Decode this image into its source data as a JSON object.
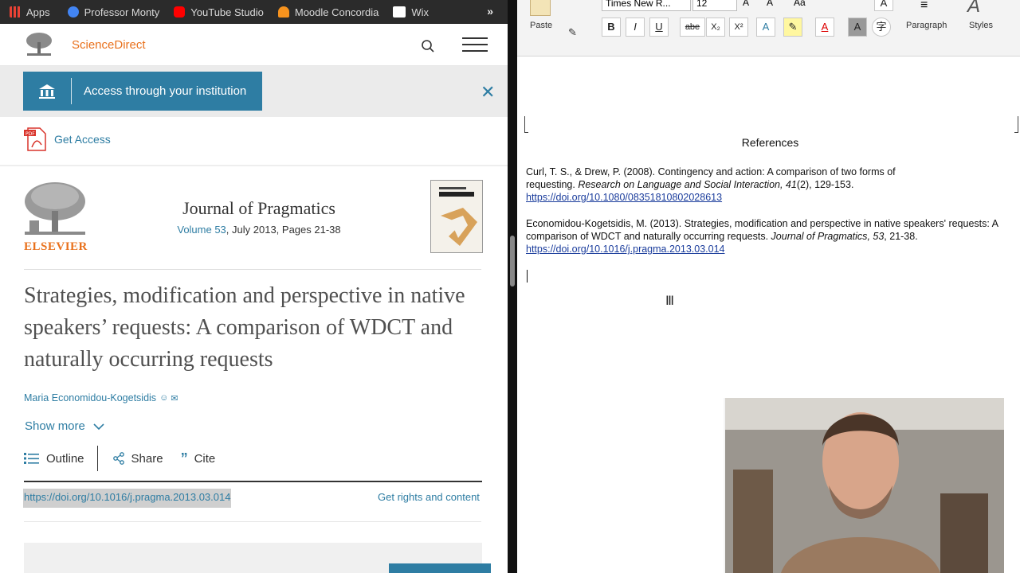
{
  "bookmarks": [
    {
      "label": "Apps",
      "color": "#e94235"
    },
    {
      "label": "Professor Monty",
      "color": "#4285f4"
    },
    {
      "label": "YouTube Studio",
      "color": "#ff0000"
    },
    {
      "label": "Moodle Concordia",
      "color": "#f7931e"
    },
    {
      "label": "Wix",
      "color": "#ffffff"
    }
  ],
  "bookmarks_more": "»",
  "sciencedirect": {
    "site_name": "ScienceDirect",
    "access_button": "Access through your institution",
    "get_access": "Get Access",
    "publisher": "ELSEVIER",
    "journal_title": "Journal of Pragmatics",
    "volume_link": "Volume 53",
    "issue_info": ", July 2013, Pages 21-38",
    "article_title": "Strategies, modification and perspective in native speakers’ requests: A comparison of WDCT and naturally occurring requests",
    "author": "Maria Economidou-Kogetsidis",
    "show_more": "Show more",
    "outline": "Outline",
    "share": "Share",
    "cite": "Cite",
    "doi": "https://doi.org/10.1016/j.pragma.2013.03.014",
    "rights": "Get rights and content"
  },
  "word": {
    "font_name": "Times New R...",
    "font_size": "12",
    "paste_label": "Paste",
    "paragraph_label": "Paragraph",
    "styles_label": "Styles",
    "format_buttons": [
      "B",
      "I",
      "U",
      "abe",
      "X₂",
      "X²"
    ],
    "heading": "References",
    "ref1_text": "Curl, T. S., & Drew, P. (2008). Contingency and action: A comparison of two forms of requesting. ",
    "ref1_journal": "Research on Language and Social Interaction",
    "ref1_vol": ", 41",
    "ref1_rest": "(2), 129-153.",
    "ref1_link": "https://doi.org/10.1080/08351810802028613",
    "ref2_text": "Economidou-Kogetsidis, M. (2013). Strategies, modification and perspective in native speakers' requests: A comparison of WDCT and naturally occurring requests. ",
    "ref2_journal": "Journal of Pragmatics",
    "ref2_vol": ", 53",
    "ref2_rest": ", 21-38.",
    "ref2_link": "https://doi.org/10.1016/j.pragma.2013.03.014"
  }
}
